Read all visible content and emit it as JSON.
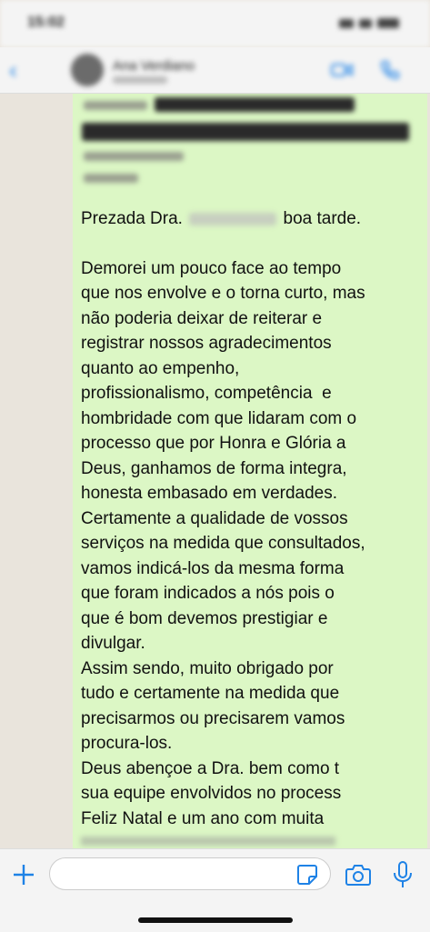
{
  "status_bar": {
    "time": "15:02"
  },
  "header": {
    "back_count": "",
    "contact_name": "Ana Verdiano",
    "icons": {
      "back": "chevron-left-icon",
      "video": "video-camera-icon",
      "call": "phone-icon"
    }
  },
  "chat": {
    "message": {
      "greeting_before": "Prezada Dra.",
      "greeting_after": "boa tarde.",
      "body": "Demorei um pouco face ao tempo\nque nos envolve e o torna curto, mas\nnão poderia deixar de reiterar e\nregistrar nossos agradecimentos\nquanto ao empenho,\nprofissionalismo, competência  e\nhombridade com que lidaram com o\nprocesso que por Honra e Glória a\nDeus, ganhamos de forma integra,\nhonesta embasado em verdades.\nCertamente a qualidade de vossos\nserviços na medida que consultados,\nvamos indicá-los da mesma forma\nque foram indicados a nós pois o\nque é bom devemos prestigiar e\ndivulgar.\nAssim sendo, muito obrigado por\ntudo e certamente na medida que\nprecisarmos ou precisarem vamos\nprocura-los.\nDeus abençoe a Dra. bem como t\nsua equipe envolvidos no process\nFeliz Natal e um ano com muita"
    },
    "colors": {
      "bubble": "#dcf7c5",
      "wallpaper": "#e9e4dc",
      "accent": "#1e82e6"
    }
  },
  "input_bar": {
    "placeholder": "",
    "icons": {
      "plus": "plus-icon",
      "sticker": "sticker-icon",
      "camera": "camera-icon",
      "mic": "microphone-icon"
    }
  }
}
